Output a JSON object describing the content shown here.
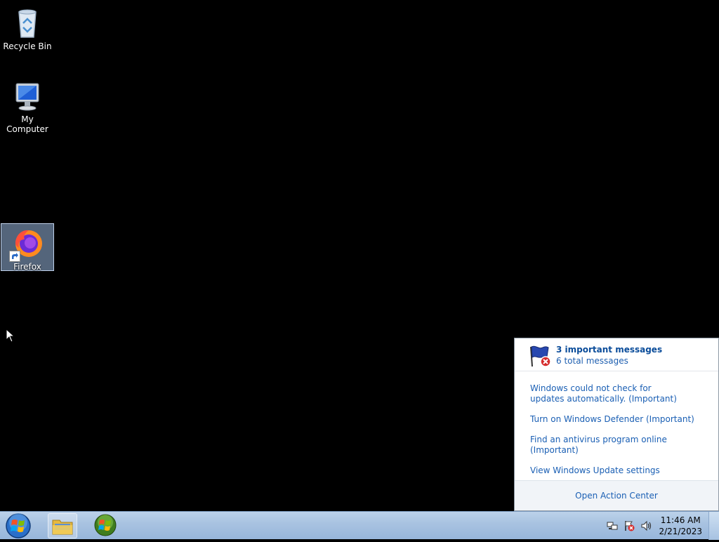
{
  "desktop": {
    "icons": [
      {
        "label": "Recycle Bin",
        "icon": "recycle-bin-icon"
      },
      {
        "label": "My Computer",
        "icon": "computer-icon"
      },
      {
        "label": "Firefox",
        "icon": "firefox-icon",
        "selected": true
      }
    ]
  },
  "action_center": {
    "header_title": "3 important messages",
    "header_subtitle": "6 total messages",
    "messages": [
      "Windows could not check for updates automatically. (Important)",
      "Turn on Windows Defender (Important)",
      "Find an antivirus program online (Important)",
      "View Windows Update settings"
    ],
    "footer_link": "Open Action Center"
  },
  "taskbar": {
    "clock_time": "11:46 AM",
    "clock_date": "2/21/2023",
    "pinned": [
      "file-explorer-icon",
      "windows-media-icon"
    ],
    "tray": [
      "network-icon",
      "action-center-flag-icon",
      "volume-icon"
    ]
  },
  "colors": {
    "link": "#1a5fb4",
    "taskbar": "#a9c3e1",
    "desktop": "#000000"
  }
}
